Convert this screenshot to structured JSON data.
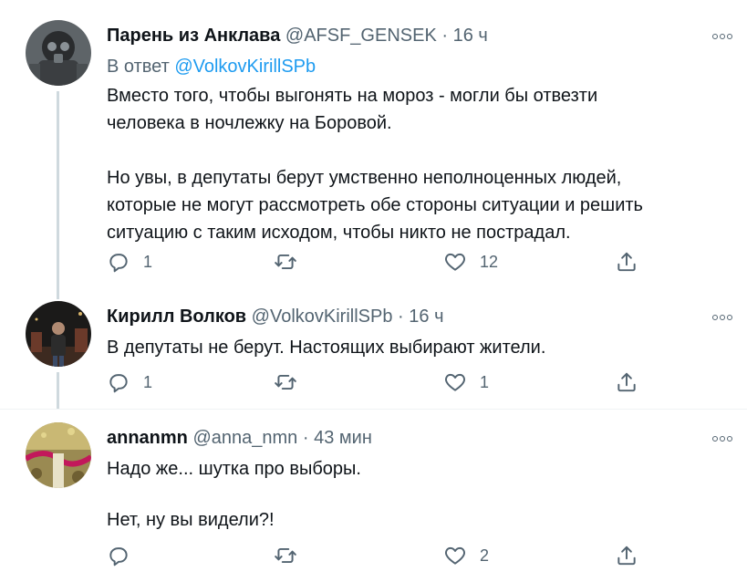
{
  "tweets": [
    {
      "name": "Парень из Анклава",
      "handle": "@AFSF_GENSEK",
      "separator": "·",
      "time": "16 ч",
      "reply_label": "В ответ",
      "reply_to": "@VolkovKirillSPb",
      "body": [
        "Вместо того, чтобы выгонять на мороз - могли бы отвезти",
        "человека в ночлежку на Боровой.",
        "",
        "Но увы, в депутаты берут умственно неполноценных людей,",
        "которые не могут рассмотреть обе стороны ситуации и решить",
        "ситуацию с таким исходом, чтобы никто не пострадал."
      ],
      "reply_count": "1",
      "retweet_count": "",
      "like_count": "12"
    },
    {
      "name": "Кирилл Волков",
      "handle": "@VolkovKirillSPb",
      "separator": "·",
      "time": "16 ч",
      "body": [
        "В депутаты не берут. Настоящих выбирают жители."
      ],
      "reply_count": "1",
      "retweet_count": "",
      "like_count": "1"
    },
    {
      "name": "annanmn",
      "handle": "@anna_nmn",
      "separator": "·",
      "time": "43 мин",
      "body": [
        "Надо же... шутка про выборы.",
        "",
        "Нет, ну вы видели?!"
      ],
      "reply_count": "",
      "retweet_count": "",
      "like_count": "2"
    }
  ],
  "colors": {
    "text": "#0f1419",
    "secondary": "#536471",
    "accent": "#1d9bf0",
    "thread_line": "#cfd9de"
  },
  "icons": [
    "reply-icon",
    "retweet-icon",
    "like-icon",
    "share-icon",
    "more-icon"
  ]
}
